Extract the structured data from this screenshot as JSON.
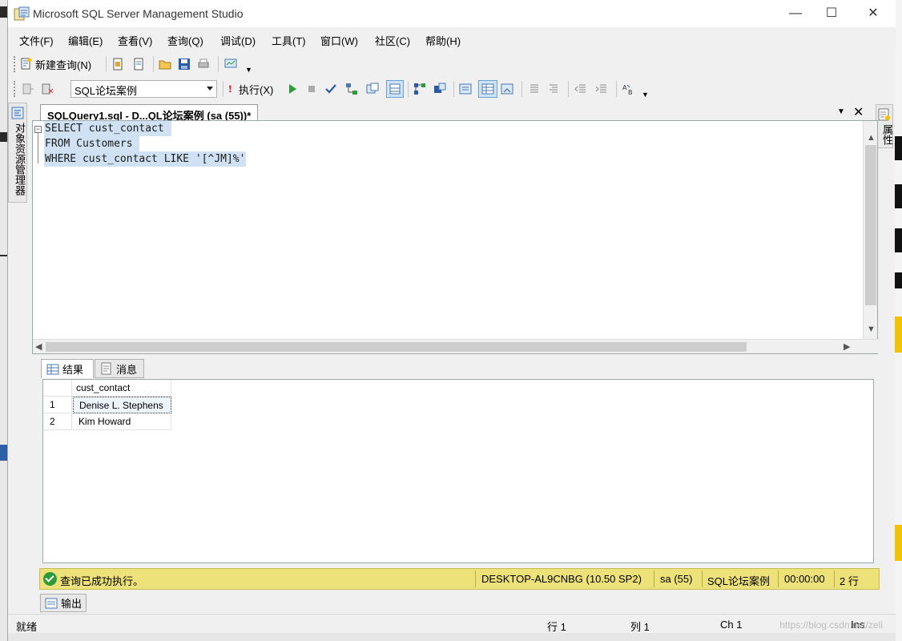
{
  "window": {
    "title": "Microsoft SQL Server Management Studio",
    "controls": {
      "minimize": "—",
      "maximize": "☐",
      "close": "✕"
    }
  },
  "menu": [
    "文件(F)",
    "编辑(E)",
    "查看(V)",
    "查询(Q)",
    "调试(D)",
    "工具(T)",
    "窗口(W)",
    "社区(C)",
    "帮助(H)"
  ],
  "toolbar1": {
    "new_query_label": "新建查询(N)"
  },
  "toolbar2": {
    "database": "SQL论坛案例",
    "execute_label": "执行(X)"
  },
  "side_panels": {
    "left": "对象资源管理器",
    "right": "属性"
  },
  "document": {
    "tab_title": "SQLQuery1.sql - D...QL论坛案例 (sa (55))*",
    "code_lines": [
      "SELECT cust_contact ",
      "FROM Customers ",
      "WHERE cust_contact LIKE '[^JM]%'"
    ]
  },
  "results": {
    "tabs": [
      "结果",
      "消息"
    ],
    "columns": [
      "cust_contact"
    ],
    "rows": [
      {
        "num": "1",
        "cust_contact": "Denise L. Stephens"
      },
      {
        "num": "2",
        "cust_contact": "Kim Howard"
      }
    ]
  },
  "query_status": {
    "message": "查询已成功执行。",
    "server": "DESKTOP-AL9CNBG (10.50 SP2)",
    "user": "sa (55)",
    "database": "SQL论坛案例",
    "elapsed": "00:00:00",
    "rows": "2 行"
  },
  "output_tab": "输出",
  "app_status": {
    "ready": "就绪",
    "line": "行 1",
    "column": "列 1",
    "char": "Ch 1",
    "mode": "Ins"
  },
  "watermark": "https://blog.csdn.net/zeli",
  "colors": {
    "status_bg": "#ede27a",
    "selection": "#cfe1f3",
    "success": "#2e9b3a"
  }
}
